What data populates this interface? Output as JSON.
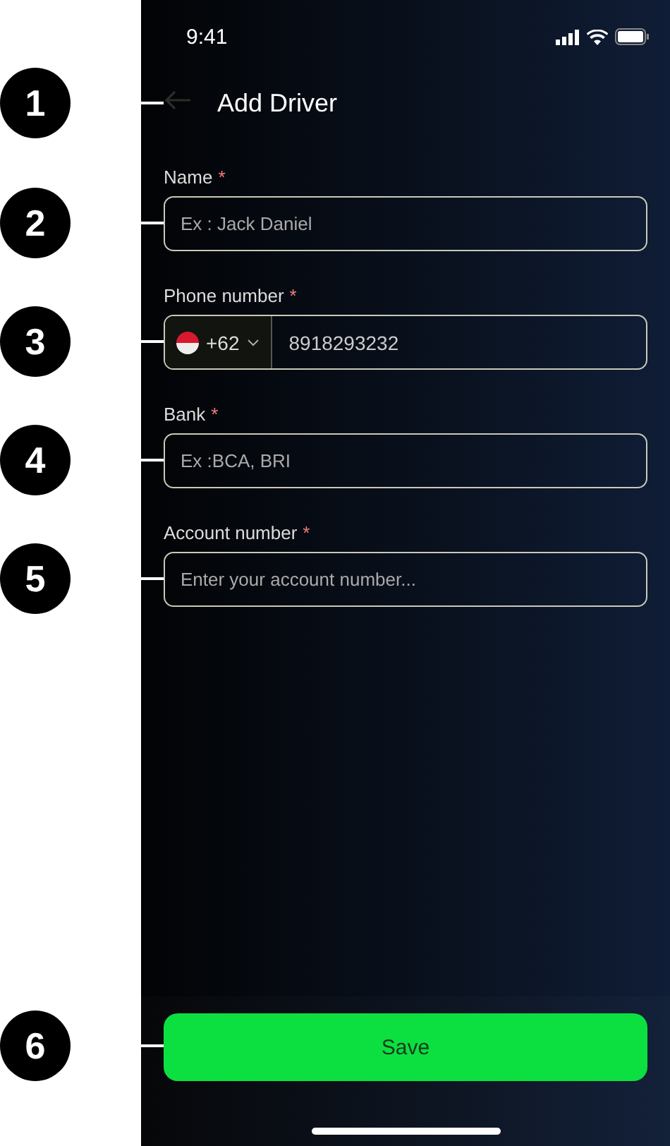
{
  "callouts": [
    "1",
    "2",
    "3",
    "4",
    "5",
    "6"
  ],
  "status_bar": {
    "time": "9:41"
  },
  "header": {
    "title": "Add Driver"
  },
  "fields": [
    {
      "kind": "text",
      "label": "Name",
      "required": "*",
      "placeholder": "Ex : Jack Daniel"
    },
    {
      "kind": "phone",
      "label": "Phone number",
      "required": "*",
      "country_code": "+62",
      "value": "8918293232"
    },
    {
      "kind": "text",
      "label": "Bank",
      "required": "*",
      "placeholder": "Ex :BCA, BRI"
    },
    {
      "kind": "text",
      "label": "Account number",
      "required": "*",
      "placeholder": "Enter your account number..."
    }
  ],
  "save_button": {
    "label": "Save"
  }
}
